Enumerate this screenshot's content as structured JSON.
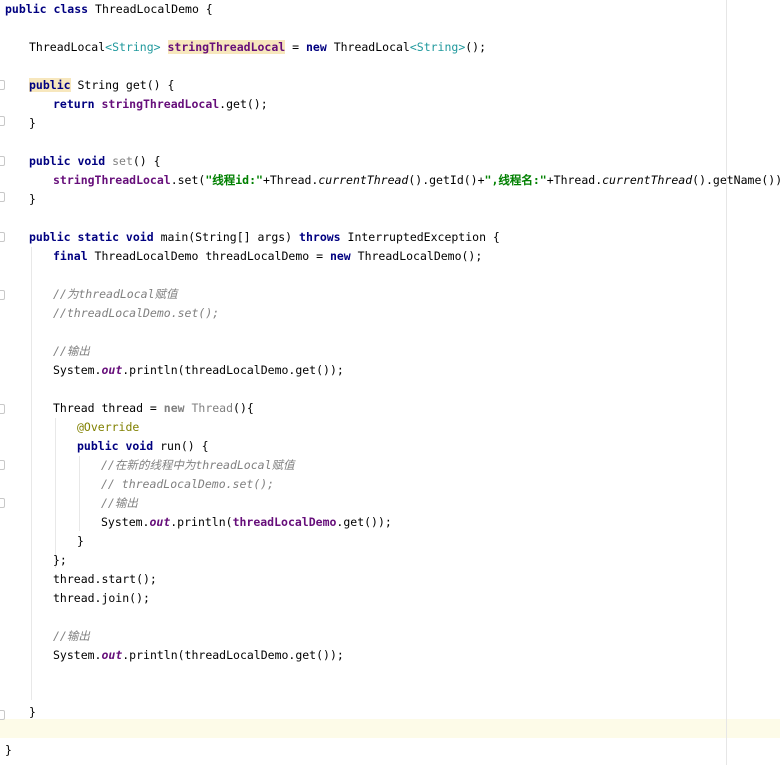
{
  "editor": {
    "language": "java",
    "class_name": "ThreadLocalDemo",
    "lines": [
      {
        "indent": 0,
        "tokens": [
          {
            "t": "public class ",
            "c": "kw"
          },
          {
            "t": "ThreadLocalDemo {"
          }
        ]
      },
      {
        "indent": 0,
        "tokens": []
      },
      {
        "indent": 1,
        "tokens": [
          {
            "t": "ThreadLocal"
          },
          {
            "t": "<String>",
            "c": "gen"
          },
          {
            "t": " "
          },
          {
            "t": "stringThreadLocal",
            "c": "field hl"
          },
          {
            "t": " = "
          },
          {
            "t": "new ",
            "c": "kw"
          },
          {
            "t": "ThreadLocal"
          },
          {
            "t": "<String>",
            "c": "gen"
          },
          {
            "t": "();"
          }
        ]
      },
      {
        "indent": 0,
        "tokens": []
      },
      {
        "indent": 1,
        "tokens": [
          {
            "t": "public",
            "c": "kw hl"
          },
          {
            "t": " String get() {"
          }
        ]
      },
      {
        "indent": 2,
        "tokens": [
          {
            "t": "return ",
            "c": "kw"
          },
          {
            "t": "stringThreadLocal",
            "c": "field"
          },
          {
            "t": ".get();"
          }
        ]
      },
      {
        "indent": 1,
        "tokens": [
          {
            "t": "}"
          }
        ]
      },
      {
        "indent": 0,
        "tokens": []
      },
      {
        "indent": 1,
        "tokens": [
          {
            "t": "public void ",
            "c": "kw"
          },
          {
            "t": "set",
            "c": "muted"
          },
          {
            "t": "() {"
          }
        ]
      },
      {
        "indent": 2,
        "tokens": [
          {
            "t": "stringThreadLocal",
            "c": "field"
          },
          {
            "t": ".set("
          },
          {
            "t": "\"线程id:\"",
            "c": "str"
          },
          {
            "t": "+Thread."
          },
          {
            "t": "currentThread",
            "c": "it"
          },
          {
            "t": "().getId()+"
          },
          {
            "t": "\",线程名:\"",
            "c": "str"
          },
          {
            "t": "+Thread."
          },
          {
            "t": "currentThread",
            "c": "it"
          },
          {
            "t": "().getName());"
          }
        ]
      },
      {
        "indent": 1,
        "tokens": [
          {
            "t": "}"
          }
        ]
      },
      {
        "indent": 0,
        "tokens": []
      },
      {
        "indent": 1,
        "tokens": [
          {
            "t": "public static void ",
            "c": "kw"
          },
          {
            "t": "main(String[] args) "
          },
          {
            "t": "throws ",
            "c": "kw"
          },
          {
            "t": "InterruptedException {"
          }
        ]
      },
      {
        "indent": 2,
        "tokens": [
          {
            "t": "final ",
            "c": "kw"
          },
          {
            "t": "ThreadLocalDemo threadLocalDemo = "
          },
          {
            "t": "new ",
            "c": "kw"
          },
          {
            "t": "ThreadLocalDemo();"
          }
        ]
      },
      {
        "indent": 0,
        "tokens": []
      },
      {
        "indent": 2,
        "tokens": [
          {
            "t": "//为threadLocal赋值",
            "c": "cmt"
          }
        ]
      },
      {
        "indent": 2,
        "tokens": [
          {
            "t": "//threadLocalDemo.set();",
            "c": "cmt"
          }
        ]
      },
      {
        "indent": 0,
        "tokens": []
      },
      {
        "indent": 2,
        "tokens": [
          {
            "t": "//输出",
            "c": "cmt"
          }
        ]
      },
      {
        "indent": 2,
        "tokens": [
          {
            "t": "System."
          },
          {
            "t": "out",
            "c": "field it"
          },
          {
            "t": ".println(threadLocalDemo.get());"
          }
        ]
      },
      {
        "indent": 0,
        "tokens": []
      },
      {
        "indent": 2,
        "tokens": [
          {
            "t": "Thread thread = "
          },
          {
            "t": "new ",
            "c": "kw muted"
          },
          {
            "t": "Thread",
            "c": "muted"
          },
          {
            "t": "(){"
          }
        ]
      },
      {
        "indent": 3,
        "tokens": [
          {
            "t": "@Override",
            "c": "ann"
          }
        ]
      },
      {
        "indent": 3,
        "tokens": [
          {
            "t": "public void ",
            "c": "kw"
          },
          {
            "t": "run() {"
          }
        ]
      },
      {
        "indent": 4,
        "tokens": [
          {
            "t": "//在新的线程中为threadLocal赋值",
            "c": "cmt"
          }
        ]
      },
      {
        "indent": 4,
        "tokens": [
          {
            "t": "// threadLocalDemo.set();",
            "c": "cmt"
          }
        ]
      },
      {
        "indent": 4,
        "tokens": [
          {
            "t": "//输出",
            "c": "cmt"
          }
        ]
      },
      {
        "indent": 4,
        "tokens": [
          {
            "t": "System."
          },
          {
            "t": "out",
            "c": "field it"
          },
          {
            "t": ".println("
          },
          {
            "t": "threadLocalDemo",
            "c": "field"
          },
          {
            "t": ".get());"
          }
        ]
      },
      {
        "indent": 3,
        "tokens": [
          {
            "t": "}"
          }
        ]
      },
      {
        "indent": 2,
        "tokens": [
          {
            "t": "};"
          }
        ]
      },
      {
        "indent": 2,
        "tokens": [
          {
            "t": "thread.start();"
          }
        ]
      },
      {
        "indent": 2,
        "tokens": [
          {
            "t": "thread.join();"
          }
        ]
      },
      {
        "indent": 0,
        "tokens": []
      },
      {
        "indent": 2,
        "tokens": [
          {
            "t": "//输出",
            "c": "cmt"
          }
        ]
      },
      {
        "indent": 2,
        "tokens": [
          {
            "t": "System."
          },
          {
            "t": "out",
            "c": "field it"
          },
          {
            "t": ".println(threadLocalDemo.get());"
          }
        ]
      },
      {
        "indent": 0,
        "tokens": []
      },
      {
        "indent": 0,
        "tokens": []
      },
      {
        "indent": 1,
        "tokens": [
          {
            "t": "}"
          }
        ]
      },
      {
        "indent": 0,
        "tokens": []
      },
      {
        "indent": 0,
        "tokens": [
          {
            "t": "}"
          }
        ]
      }
    ],
    "current_line_index": 38,
    "colors": {
      "keyword": "#000080",
      "field": "#660e7a",
      "string": "#008000",
      "comment": "#808080",
      "annotation": "#808000",
      "current_line": "#fdfbe8",
      "highlight": "#f7e7bd"
    }
  }
}
